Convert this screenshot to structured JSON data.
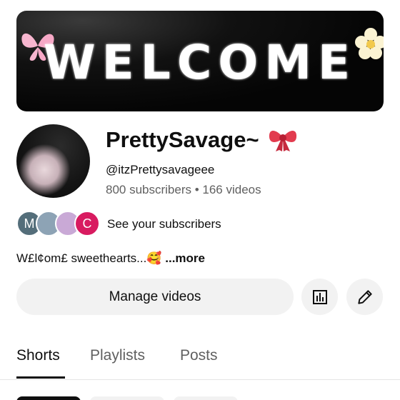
{
  "banner": {
    "text": "WELCOME"
  },
  "channel": {
    "name": "PrettySavage~",
    "handle": "@itzPrettysavageee",
    "stats": "800 subscribers • 166 videos"
  },
  "subscribers": {
    "avatars": [
      {
        "letter": "M",
        "color": "#546e7a"
      },
      {
        "letter": "",
        "color": "#8da3b5"
      },
      {
        "letter": "",
        "color": "#c9a9d6"
      },
      {
        "letter": "C",
        "color": "#d81b60"
      }
    ],
    "link_label": "See your subscribers"
  },
  "description": {
    "text": "W£l¢om£ sweethearts...🥰 ",
    "more_label": "...more"
  },
  "actions": {
    "manage_label": "Manage videos"
  },
  "tabs": [
    {
      "label": "Shorts",
      "active": true
    },
    {
      "label": "Playlists",
      "active": false
    },
    {
      "label": "Posts",
      "active": false
    }
  ]
}
